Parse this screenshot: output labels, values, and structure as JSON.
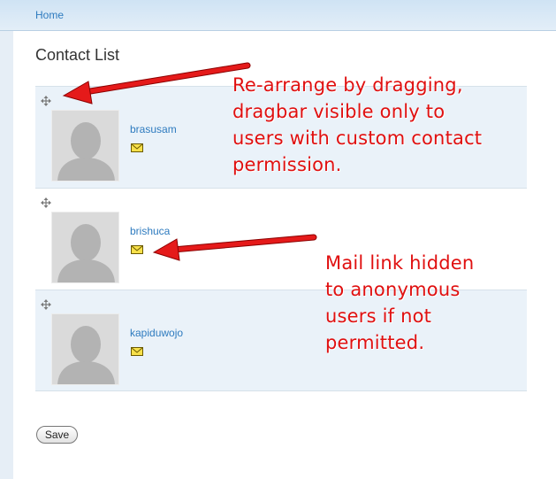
{
  "breadcrumb": {
    "home_label": "Home"
  },
  "page": {
    "title": "Contact List"
  },
  "contacts": [
    {
      "username": "brasusam"
    },
    {
      "username": "brishuca"
    },
    {
      "username": "kapiduwojo"
    }
  ],
  "icons": {
    "drag_handle": "move-cross-icon",
    "mail": "envelope-icon",
    "avatar": "user-silhouette-icon"
  },
  "form": {
    "save_label": "Save"
  },
  "annotations": {
    "drag_note": "Re-arrange by dragging,\ndragbar visible only to\nusers with custom contact\npermission.",
    "mail_note": "Mail link hidden\nto anonymous\nusers if not\npermitted."
  },
  "colors": {
    "link": "#2e7bbf",
    "annotation": "#e01010",
    "row_alt": "#eaf2f9",
    "mail_icon": "#f7e04a"
  }
}
